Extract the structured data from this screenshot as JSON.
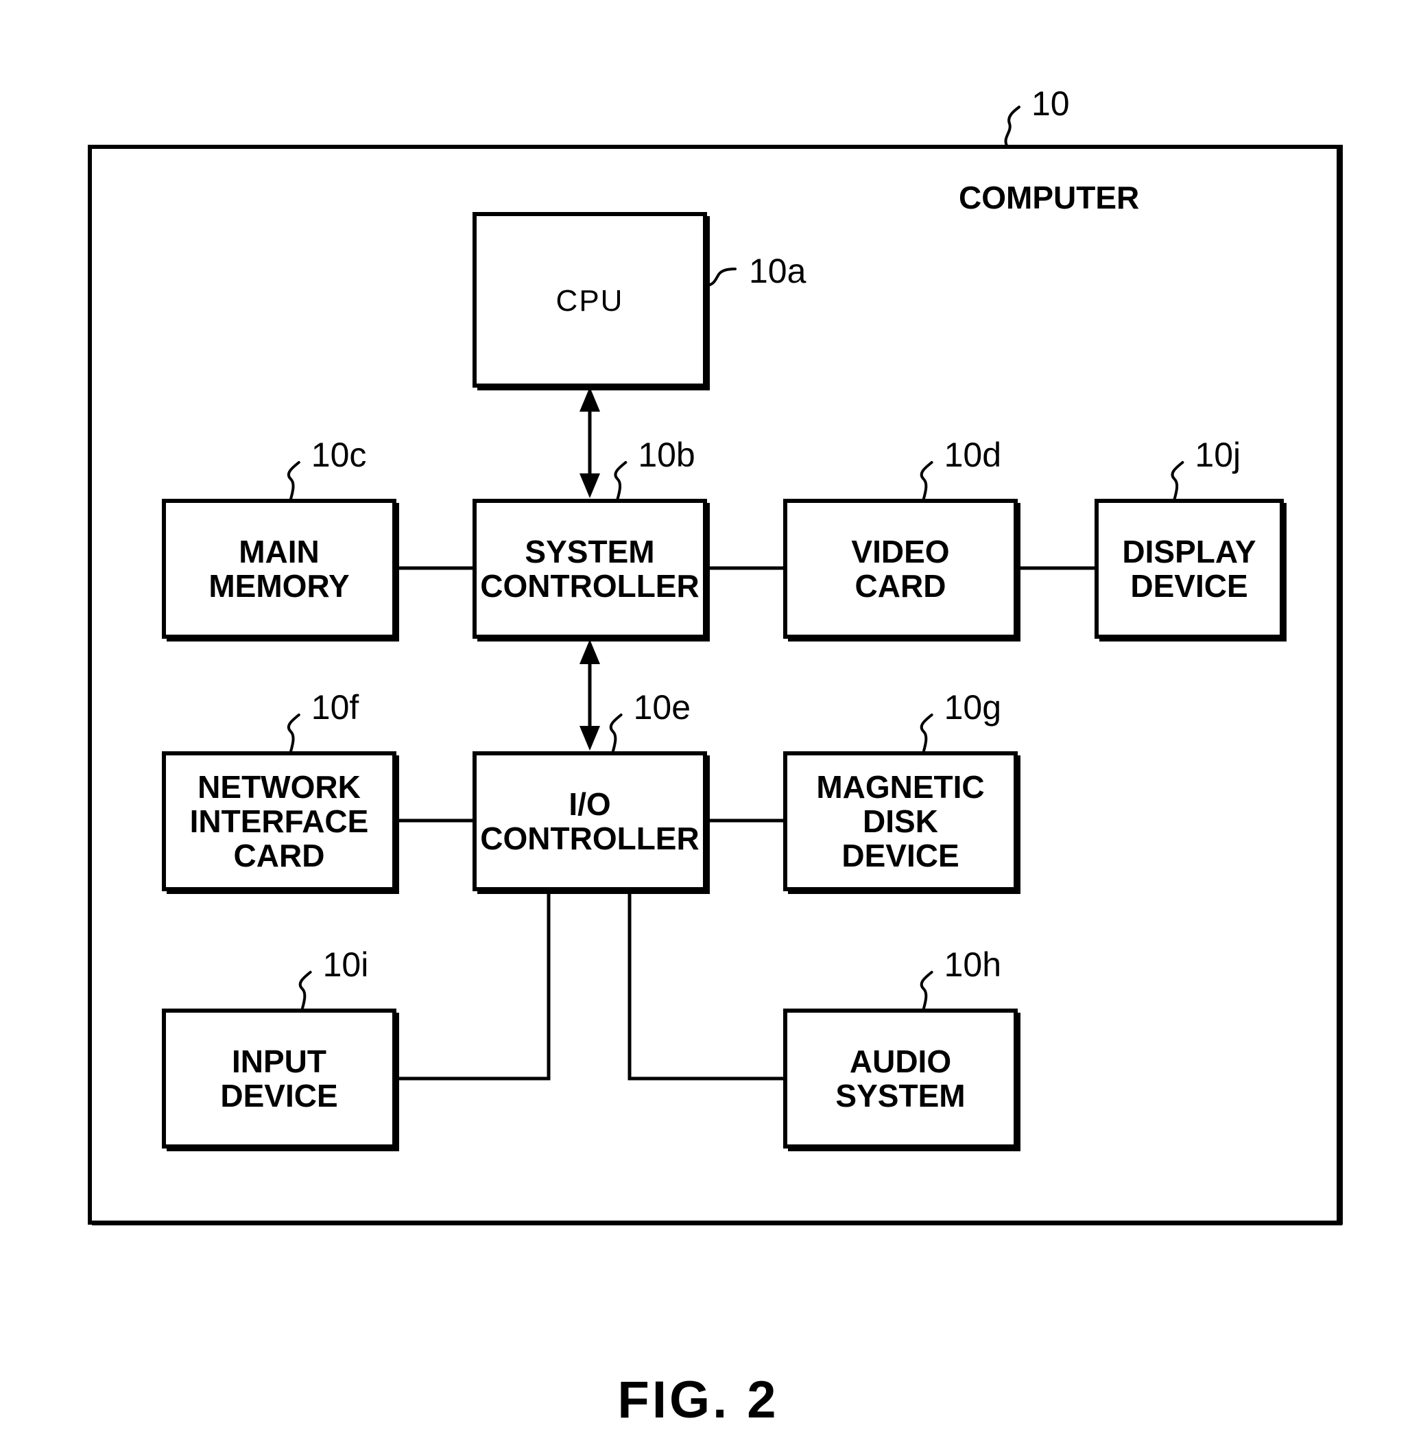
{
  "figure": {
    "caption": "FIG. 2",
    "container": {
      "ref": "10",
      "title": "COMPUTER"
    }
  },
  "components": {
    "cpu": {
      "ref": "10a",
      "lines": [
        "CPU"
      ]
    },
    "system_controller": {
      "ref": "10b",
      "lines": [
        "SYSTEM",
        "CONTROLLER"
      ]
    },
    "main_memory": {
      "ref": "10c",
      "lines": [
        "MAIN",
        "MEMORY"
      ]
    },
    "video_card": {
      "ref": "10d",
      "lines": [
        "VIDEO",
        "CARD"
      ]
    },
    "io_controller": {
      "ref": "10e",
      "lines": [
        "I/O",
        "CONTROLLER"
      ]
    },
    "network_interface_card": {
      "ref": "10f",
      "lines": [
        "NETWORK",
        "INTERFACE",
        "CARD"
      ]
    },
    "magnetic_disk_device": {
      "ref": "10g",
      "lines": [
        "MAGNETIC",
        "DISK",
        "DEVICE"
      ]
    },
    "audio_system": {
      "ref": "10h",
      "lines": [
        "AUDIO",
        "SYSTEM"
      ]
    },
    "input_device": {
      "ref": "10i",
      "lines": [
        "INPUT",
        "DEVICE"
      ]
    },
    "display_device": {
      "ref": "10j",
      "lines": [
        "DISPLAY",
        "DEVICE"
      ]
    }
  },
  "connections": [
    {
      "from": "cpu",
      "to": "system_controller",
      "type": "bidirectional-arrow"
    },
    {
      "from": "system_controller",
      "to": "io_controller",
      "type": "bidirectional-arrow"
    },
    {
      "from": "main_memory",
      "to": "system_controller",
      "type": "line"
    },
    {
      "from": "system_controller",
      "to": "video_card",
      "type": "line"
    },
    {
      "from": "video_card",
      "to": "display_device",
      "type": "line"
    },
    {
      "from": "network_interface_card",
      "to": "io_controller",
      "type": "line"
    },
    {
      "from": "io_controller",
      "to": "magnetic_disk_device",
      "type": "line"
    },
    {
      "from": "io_controller",
      "to": "input_device",
      "type": "elbow-line"
    },
    {
      "from": "io_controller",
      "to": "audio_system",
      "type": "elbow-line"
    }
  ]
}
